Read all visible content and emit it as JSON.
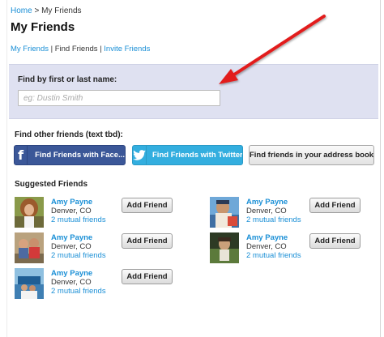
{
  "breadcrumb": {
    "home": "Home",
    "separator": ">",
    "current": "My Friends"
  },
  "page_title": "My Friends",
  "subnav": {
    "my_friends": "My Friends",
    "separator": "|",
    "find_friends": "Find Friends",
    "invite_friends": "Invite Friends"
  },
  "search": {
    "label": "Find by first or last name:",
    "placeholder": "eg: Dustin Smith",
    "value": ""
  },
  "find_other": {
    "label": "Find other friends (text tbd):",
    "facebook_button": "Find Friends with Face...",
    "twitter_button": "Find Friends with Twitter",
    "address_book_button": "Find friends in your address book"
  },
  "suggested": {
    "label": "Suggested Friends",
    "people": [
      {
        "name": "Amy Payne",
        "location": "Denver, CO",
        "mutual": "2 mutual friends",
        "button": "Add Friend"
      },
      {
        "name": "Amy Payne",
        "location": "Denver, CO",
        "mutual": "2 mutual friends",
        "button": "Add Friend"
      },
      {
        "name": "Amy Payne",
        "location": "Denver, CO",
        "mutual": "2 mutual friends",
        "button": "Add Friend"
      },
      {
        "name": "Amy Payne",
        "location": "Denver, CO",
        "mutual": "2 mutual friends",
        "button": "Add Friend"
      },
      {
        "name": "Amy Payne",
        "location": "Denver, CO",
        "mutual": "2 mutual friends",
        "button": "Add Friend"
      }
    ]
  },
  "icons": {
    "facebook": "facebook-f-icon",
    "twitter": "twitter-bird-icon",
    "annotation": "red-arrow-annotation"
  },
  "colors": {
    "link": "#1a8fd6",
    "facebook": "#3b5798",
    "twitter": "#33aedf",
    "panel": "#dfe1f1",
    "arrow": "#e21f1f"
  }
}
